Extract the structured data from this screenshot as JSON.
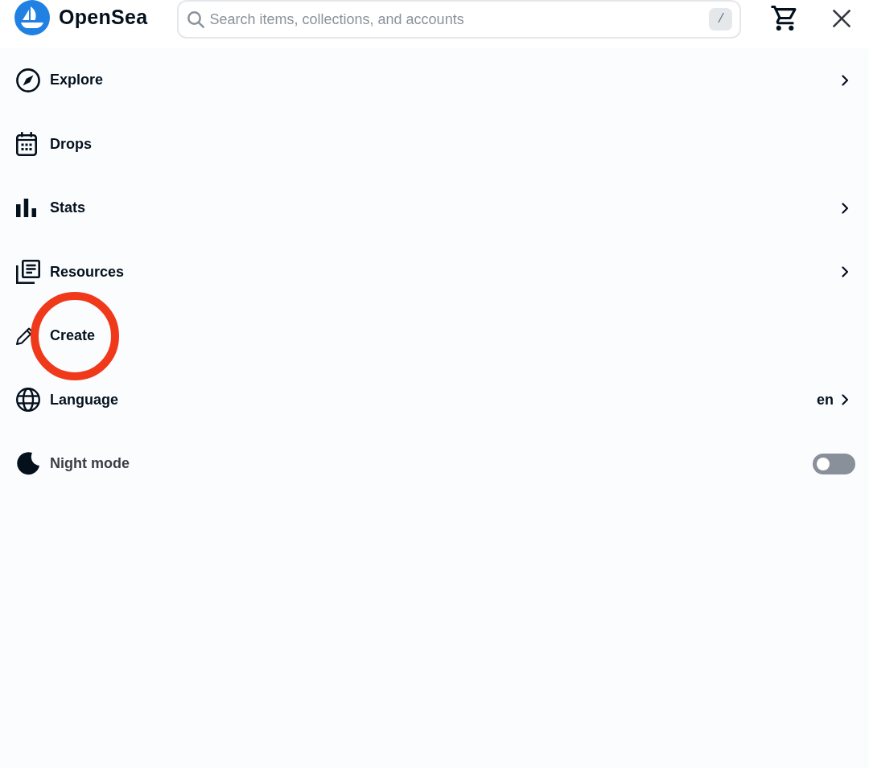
{
  "header": {
    "logo": {
      "name": "OpenSea"
    },
    "search": {
      "placeholder": "Search items, collections, and accounts",
      "shortcut": "/"
    }
  },
  "menu": {
    "items": [
      {
        "kind": "link",
        "label": "Explore",
        "expandable": true,
        "circled": false
      },
      {
        "kind": "link",
        "label": "Drops",
        "expandable": false,
        "circled": false
      },
      {
        "kind": "link",
        "label": "Stats",
        "expandable": true,
        "circled": false
      },
      {
        "kind": "link",
        "label": "Resources",
        "expandable": true,
        "circled": false
      },
      {
        "kind": "link",
        "label": "Create",
        "expandable": false,
        "circled": true
      },
      {
        "kind": "link",
        "label": "Language",
        "value": "en",
        "expandable": true,
        "circled": false
      },
      {
        "kind": "toggle",
        "label": "Night mode",
        "on": false,
        "circled": false
      }
    ]
  }
}
